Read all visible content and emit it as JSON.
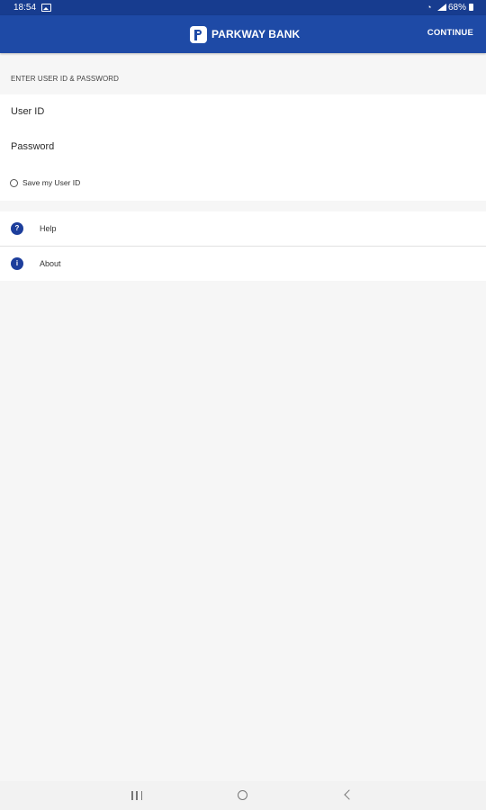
{
  "status_bar": {
    "time": "18:54",
    "battery": "68%",
    "icons": [
      "gallery-icon",
      "wifi-icon",
      "signal-icon",
      "battery-icon"
    ]
  },
  "header": {
    "brand": "PARKWAY BANK",
    "brand_icon": "parkway-logo-icon",
    "continue_label": "CONTINUE",
    "background": "#1e4aa6"
  },
  "login": {
    "section_title": "ENTER USER ID & PASSWORD",
    "userid_placeholder": "User ID",
    "userid_value": "",
    "password_placeholder": "Password",
    "password_value": "",
    "save_userid_label": "Save my User ID",
    "save_userid_checked": false
  },
  "menu": {
    "items": [
      {
        "label": "Help",
        "icon": "help-icon",
        "glyph": "?"
      },
      {
        "label": "About",
        "icon": "info-icon",
        "glyph": "i"
      }
    ]
  },
  "nav_bar": {
    "icons": [
      "recents-icon",
      "home-icon",
      "back-icon"
    ]
  },
  "colors": {
    "accent": "#1e4aa6",
    "status_bar": "#173c8f",
    "background": "#f6f6f6"
  }
}
